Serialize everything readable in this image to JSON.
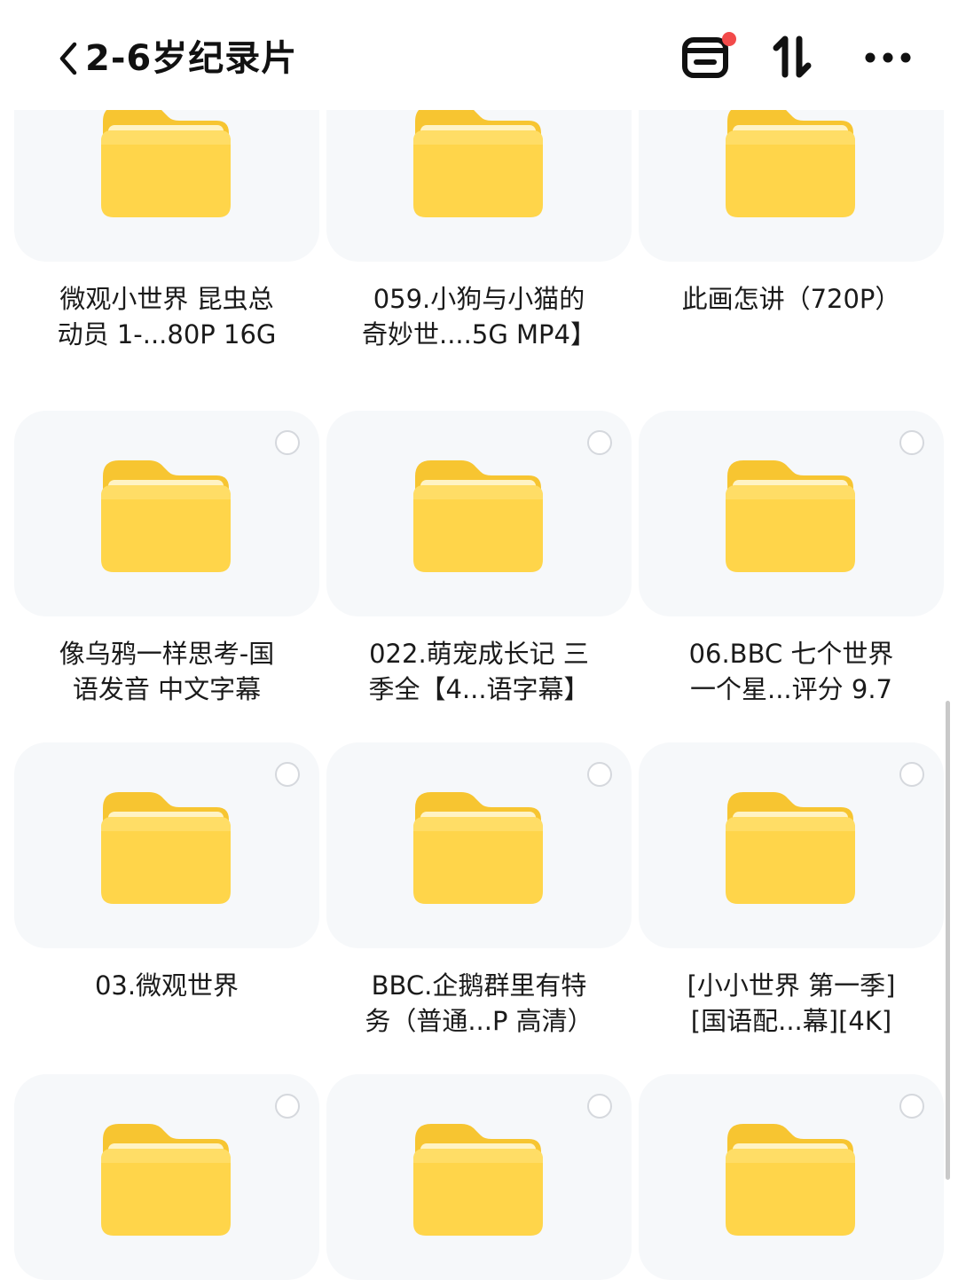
{
  "header": {
    "title": "2-6岁纪录片",
    "has_notification": true
  },
  "colors": {
    "folder_body": "#FFD54A",
    "folder_tab": "#F7C531",
    "tile_bg": "#F6F8FA",
    "notification_dot": "#F24A4A"
  },
  "icons": {
    "back": "chevron-left-icon",
    "recent": "window-icon",
    "sort": "sort-arrows-icon",
    "more": "more-dots-icon",
    "folder": "folder-icon",
    "select": "select-circle-icon"
  },
  "folders": [
    {
      "label": "微观小世界 昆虫总\n动员 1-...80P 16G"
    },
    {
      "label": "059.小狗与小猫的\n奇妙世....5G MP4】"
    },
    {
      "label": "此画怎讲（720P）"
    },
    {
      "label": "像乌鸦一样思考-国\n语发音 中文字幕"
    },
    {
      "label": "022.萌宠成长记 三\n季全【4...语字幕】"
    },
    {
      "label": "06.BBC 七个世界\n一个星...评分 9.7"
    },
    {
      "label": "03.微观世界"
    },
    {
      "label": "BBC.企鹅群里有特\n务（普通...P 高清）"
    },
    {
      "label": "[小小世界 第一季]\n[国语配...幕][4K]"
    },
    {
      "label": ""
    },
    {
      "label": ""
    },
    {
      "label": ""
    }
  ]
}
